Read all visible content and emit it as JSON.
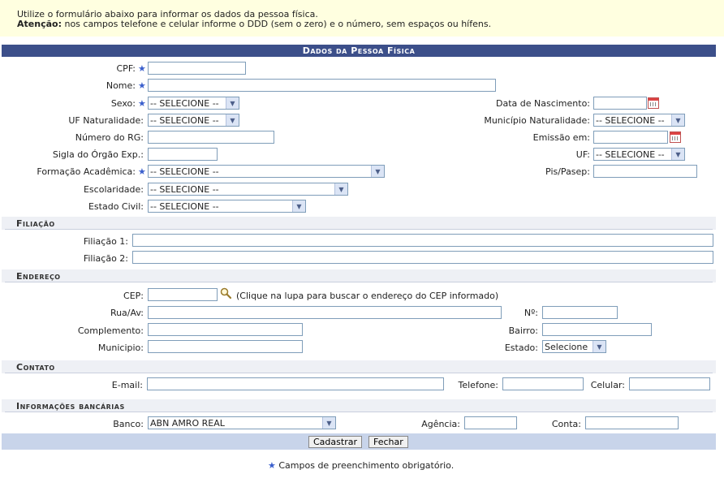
{
  "notice": {
    "line1": "Utilize o formulário abaixo para informar os dados da pessoa física.",
    "attention_label": "Atenção:",
    "line2": "nos campos telefone e celular informe o DDD (sem o zero) e o número, sem espaços ou hífens."
  },
  "form_title": "Dados da Pessoa Física",
  "personal": {
    "cpf_label": "CPF:",
    "nome_label": "Nome:",
    "sexo_label": "Sexo:",
    "sexo_value": "-- SELECIONE --",
    "data_nasc_label": "Data de Nascimento:",
    "uf_nat_label": "UF Naturalidade:",
    "uf_nat_value": "-- SELECIONE --",
    "mun_nat_label": "Município Naturalidade:",
    "mun_nat_value": "-- SELECIONE --",
    "rg_label": "Número do RG:",
    "emissao_label": "Emissão em:",
    "orgao_label": "Sigla do Órgão Exp.:",
    "uf_label": "UF:",
    "uf_value": "-- SELECIONE --",
    "formacao_label": "Formação Acadêmica:",
    "formacao_value": "-- SELECIONE --",
    "pis_label": "Pis/Pasep:",
    "escolaridade_label": "Escolaridade:",
    "escolaridade_value": "-- SELECIONE --",
    "estado_civil_label": "Estado Civil:",
    "estado_civil_value": "-- SELECIONE --"
  },
  "filiacao": {
    "title": "Filiação",
    "f1_label": "Filiação 1:",
    "f2_label": "Filiação 2:"
  },
  "endereco": {
    "title": "Endereço",
    "cep_label": "CEP:",
    "cep_hint": "(Clique na lupa para buscar o endereço do CEP informado)",
    "rua_label": "Rua/Av:",
    "numero_label": "Nº:",
    "complemento_label": "Complemento:",
    "bairro_label": "Bairro:",
    "municipio_label": "Municipio:",
    "estado_label": "Estado:",
    "estado_value": "Selecione"
  },
  "contato": {
    "title": "Contato",
    "email_label": "E-mail:",
    "telefone_label": "Telefone:",
    "celular_label": "Celular:"
  },
  "banco": {
    "title": "Informações bancárias",
    "banco_label": "Banco:",
    "banco_value": "ABN AMRO REAL",
    "agencia_label": "Agência:",
    "conta_label": "Conta:"
  },
  "actions": {
    "cadastrar": "Cadastrar",
    "fechar": "Fechar"
  },
  "footer": {
    "required_note": "Campos de preenchimento obrigatório."
  },
  "colors": {
    "title_bg": "#3c4f8a",
    "notice_bg": "#ffffe0",
    "required_star": "#3a5fcd"
  }
}
